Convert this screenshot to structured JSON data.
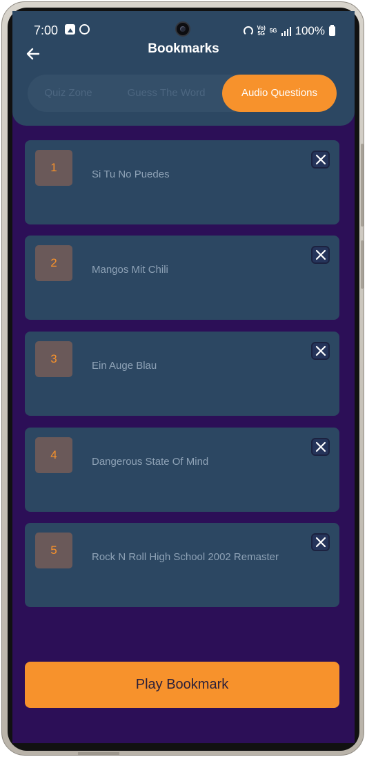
{
  "status_bar": {
    "time": "7:00",
    "battery": "100%",
    "net_top": "Vo)",
    "net_bottom": "5G",
    "net2": "5G"
  },
  "header": {
    "title": "Bookmarks",
    "back_icon": "arrow-left-icon"
  },
  "tabs": [
    {
      "label": "Quiz Zone",
      "active": false
    },
    {
      "label": "Guess The Word",
      "active": false
    },
    {
      "label": "Audio Questions",
      "active": true
    }
  ],
  "bookmarks": [
    {
      "number": "1",
      "title": "Si Tu No Puedes"
    },
    {
      "number": "2",
      "title": "Mangos Mit Chili"
    },
    {
      "number": "3",
      "title": "Ein Auge Blau"
    },
    {
      "number": "4",
      "title": "Dangerous State Of Mind"
    },
    {
      "number": "5",
      "title": "Rock N Roll High School 2002 Remaster"
    }
  ],
  "play_button": {
    "label": "Play Bookmark"
  },
  "colors": {
    "background": "#2c0f57",
    "card": "#2c4762",
    "accent": "#f7922c",
    "number_box": "#6a5959",
    "card_text": "#8ea2b6"
  }
}
